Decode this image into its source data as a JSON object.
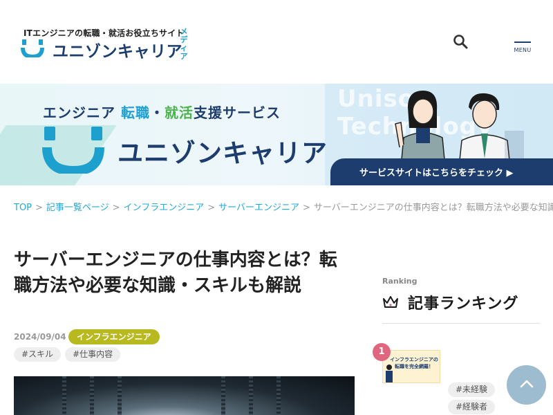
{
  "header": {
    "tagline": "ITエンジニアの転職・就活お役立ちサイト",
    "logo_name": "ユニゾンキャリア",
    "media_label": "メディア",
    "menu_label": "MENU",
    "search_icon": "search-icon"
  },
  "banner": {
    "headline_part1": "エンジニア",
    "headline_part2": "転職",
    "headline_part3": "・",
    "headline_part4": "就活",
    "headline_part5": "支援サービス",
    "logo_name": "ユニゾンキャリア",
    "watermark_line1": "Unison",
    "watermark_line2": "Technology",
    "cta_label": "サービスサイトはこちらをチェック ▶"
  },
  "breadcrumb": {
    "items": [
      "TOP",
      "記事一覧ページ",
      "インフラエンジニア",
      "サーバーエンジニア"
    ],
    "separator": ">",
    "current": "サーバーエンジニアの仕事内容とは？転職方法や必要な知識・スキルも解説"
  },
  "article": {
    "title": "サーバーエンジニアの仕事内容とは？転職方法や必要な知識・スキルも解説",
    "date": "2024/09/04",
    "category": "インフラエンジニア",
    "tags": [
      "#スキル",
      "#仕事内容"
    ]
  },
  "sidebar": {
    "ranking_en": "Ranking",
    "ranking_title": "記事ランキング",
    "items": [
      {
        "rank": "1",
        "thumb_text": "インフラエンジニアの転職を完全網羅！",
        "tags": [
          "#未経験",
          "#経験者"
        ]
      }
    ]
  },
  "colors": {
    "brand_navy": "#1d3d6e",
    "brand_cyan": "#23a8d6",
    "category_olive": "#b8b81f",
    "rank_pink": "#e06680",
    "back_to_top": "#9dbcd0"
  }
}
